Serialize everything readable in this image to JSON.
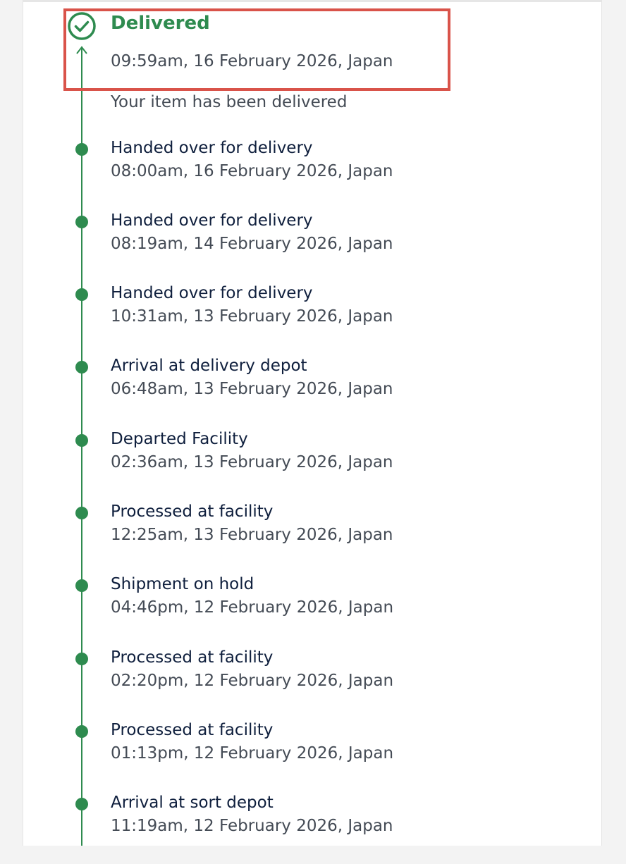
{
  "tracking": {
    "latest": {
      "status": "Delivered",
      "timestamp": "09:59am, 16 February 2026, Japan",
      "description": "Your item has been delivered",
      "icon": "check-circle-icon",
      "highlight_color": "#d9534a"
    },
    "events": [
      {
        "title": "Handed over for delivery",
        "timestamp": "08:00am, 16 February 2026, Japan"
      },
      {
        "title": "Handed over for delivery",
        "timestamp": "08:19am, 14 February 2026, Japan"
      },
      {
        "title": "Handed over for delivery",
        "timestamp": "10:31am, 13 February 2026, Japan"
      },
      {
        "title": "Arrival at delivery depot",
        "timestamp": "06:48am, 13 February 2026, Japan"
      },
      {
        "title": "Departed Facility",
        "timestamp": "02:36am, 13 February 2026, Japan"
      },
      {
        "title": "Processed at facility",
        "timestamp": "12:25am, 13 February 2026, Japan"
      },
      {
        "title": "Shipment on hold",
        "timestamp": "04:46pm, 12 February 2026, Japan"
      },
      {
        "title": "Processed at facility",
        "timestamp": "02:20pm, 12 February 2026, Japan"
      },
      {
        "title": "Processed at facility",
        "timestamp": "01:13pm, 12 February 2026, Japan"
      },
      {
        "title": "Arrival at sort depot",
        "timestamp": "11:19am, 12 February 2026, Japan"
      }
    ]
  },
  "colors": {
    "accent_green": "#2e8b4f",
    "title_navy": "#0f1f3d",
    "text_gray": "#444b55",
    "page_background": "#f3f3f3"
  }
}
